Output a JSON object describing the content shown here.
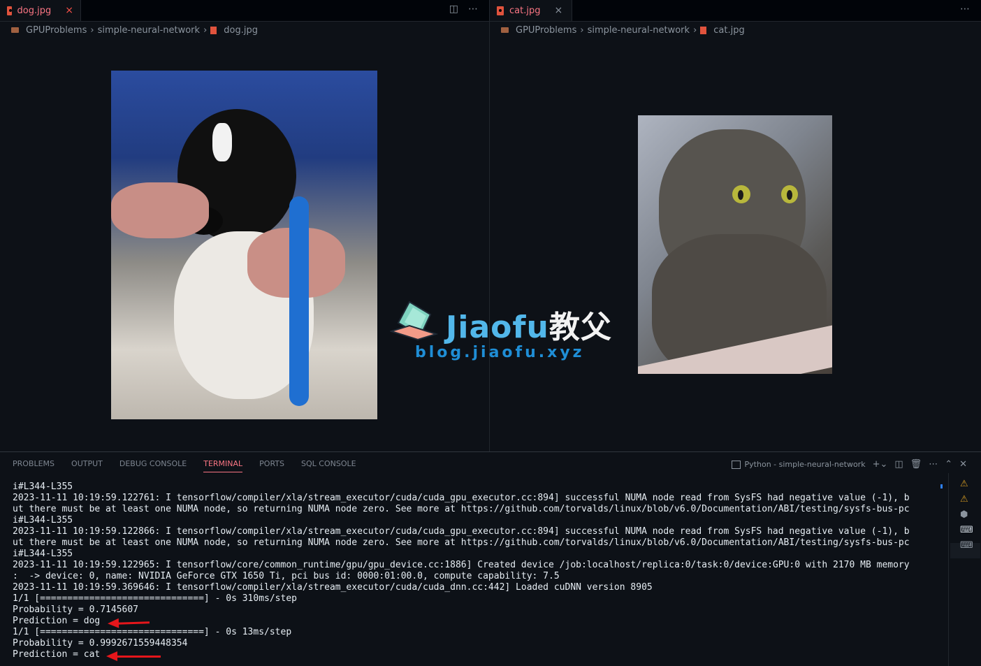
{
  "left_editor": {
    "tab_label": "dog.jpg",
    "close_glyph": "×",
    "breadcrumb": [
      "GPUProblems",
      "simple-neural-network",
      "dog.jpg"
    ],
    "image_name": "dog"
  },
  "right_editor": {
    "tab_label": "cat.jpg",
    "close_glyph": "×",
    "breadcrumb": [
      "GPUProblems",
      "simple-neural-network",
      "cat.jpg"
    ],
    "image_name": "cat"
  },
  "watermark": {
    "title": "Jiaofu",
    "title_cn": "教父",
    "url": "blog.jiaofu.xyz"
  },
  "panel": {
    "tabs": [
      "PROBLEMS",
      "OUTPUT",
      "DEBUG CONSOLE",
      "TERMINAL",
      "PORTS",
      "SQL CONSOLE"
    ],
    "active_tab": "TERMINAL",
    "terminal_name": "Python - simple-neural-network"
  },
  "terminal_lines": [
    "i#L344-L355",
    "2023-11-11 10:19:59.122761: I tensorflow/compiler/xla/stream_executor/cuda/cuda_gpu_executor.cc:894] successful NUMA node read from SysFS had negative value (-1), b",
    "ut there must be at least one NUMA node, so returning NUMA node zero. See more at https://github.com/torvalds/linux/blob/v6.0/Documentation/ABI/testing/sysfs-bus-pc",
    "i#L344-L355",
    "2023-11-11 10:19:59.122866: I tensorflow/compiler/xla/stream_executor/cuda/cuda_gpu_executor.cc:894] successful NUMA node read from SysFS had negative value (-1), b",
    "ut there must be at least one NUMA node, so returning NUMA node zero. See more at https://github.com/torvalds/linux/blob/v6.0/Documentation/ABI/testing/sysfs-bus-pc",
    "i#L344-L355",
    "2023-11-11 10:19:59.122965: I tensorflow/core/common_runtime/gpu/gpu_device.cc:1886] Created device /job:localhost/replica:0/task:0/device:GPU:0 with 2170 MB memory",
    ":  -> device: 0, name: NVIDIA GeForce GTX 1650 Ti, pci bus id: 0000:01:00.0, compute capability: 7.5",
    "2023-11-11 10:19:59.369646: I tensorflow/compiler/xla/stream_executor/cuda/cuda_dnn.cc:442] Loaded cuDNN version 8905",
    "1/1 [==============================] - 0s 310ms/step",
    "Probability = 0.7145607",
    "Prediction = dog",
    "1/1 [==============================] - 0s 13ms/step",
    "Probability = 0.9992671559448354",
    "Prediction = cat"
  ],
  "icons": {
    "split": "split-editor-icon",
    "more": "more-actions-icon",
    "add": "add-terminal-icon",
    "trash": "trash-icon",
    "maximize": "maximize-panel-icon",
    "close": "close-panel-icon"
  },
  "colors": {
    "background": "#0d1117",
    "accent": "#f97583",
    "arrow": "#e5161b",
    "watermark_blue": "#52b7ea"
  }
}
